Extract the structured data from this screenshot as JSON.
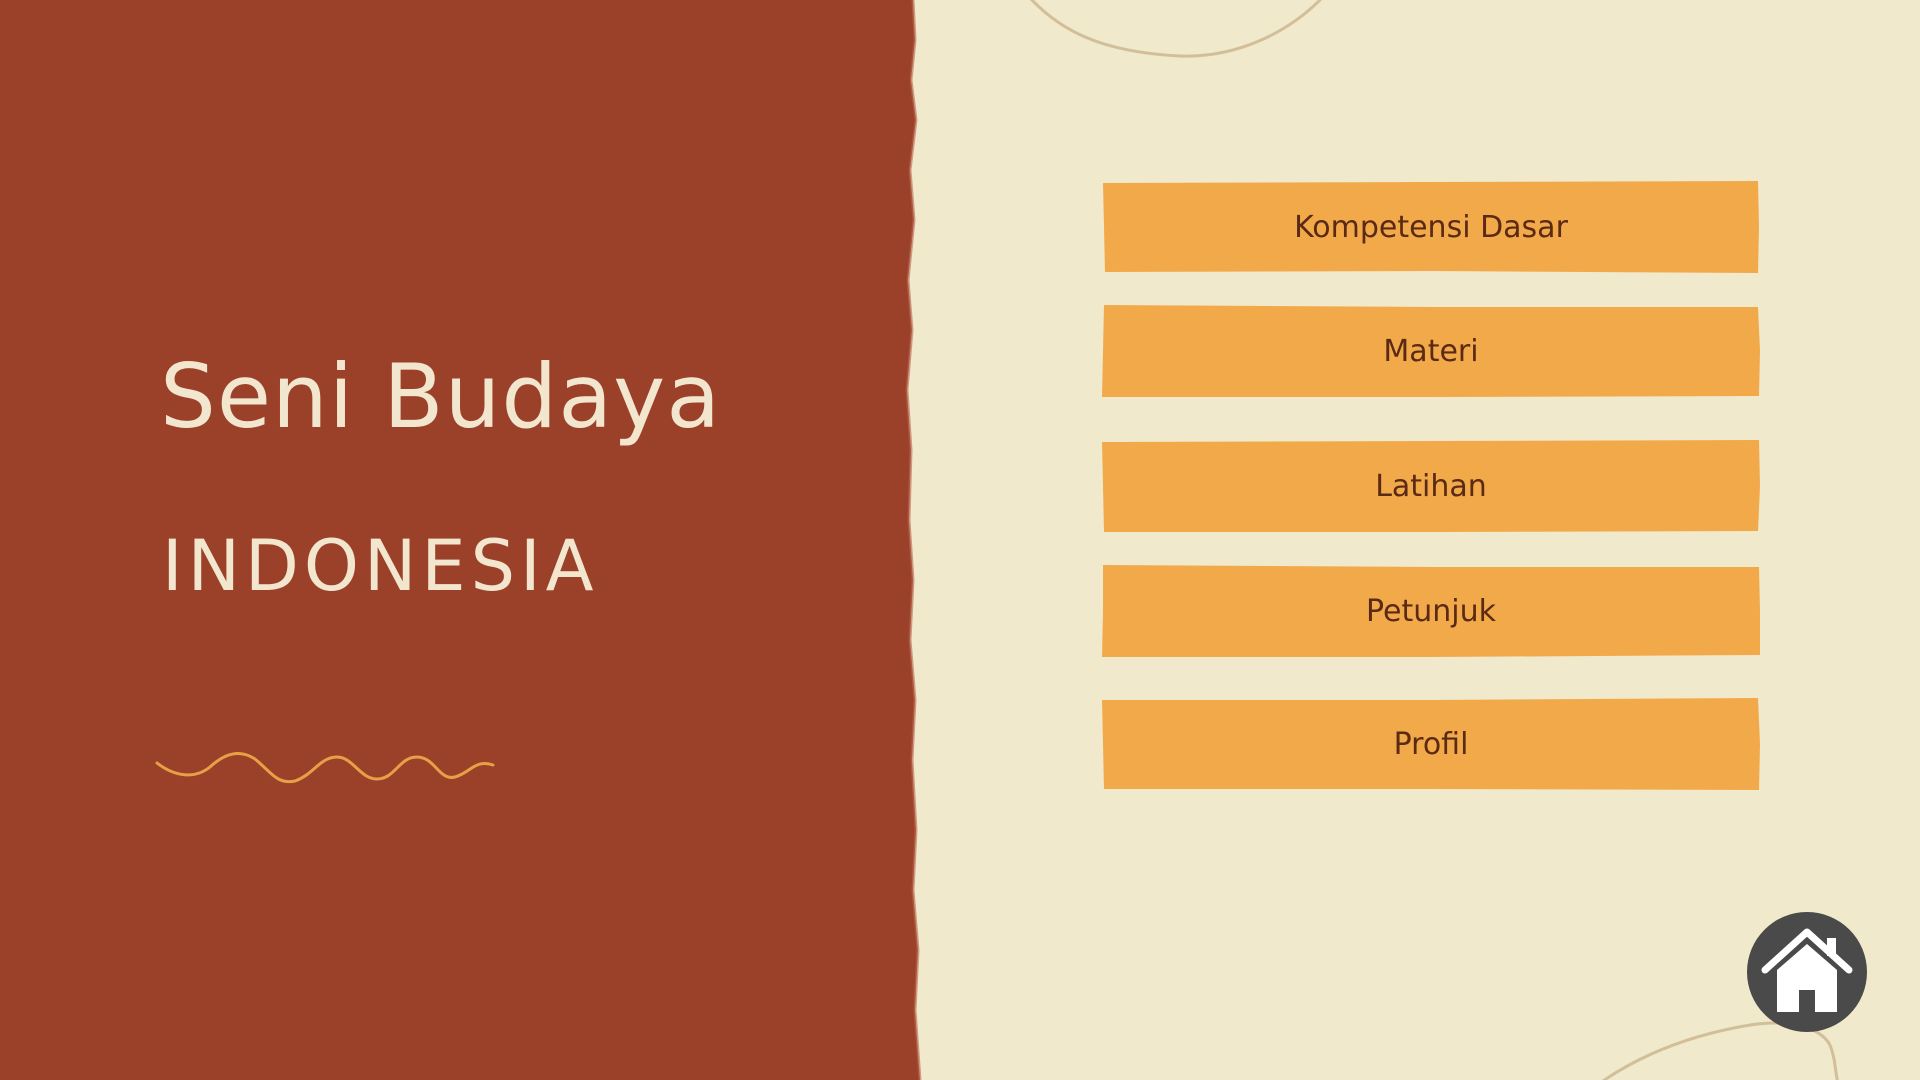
{
  "theme": {
    "left_panel_color": "#9b412a",
    "background_color": "#f0e9cc",
    "title_color": "#f3e6cf",
    "button_color": "#f2a94a",
    "button_text_color": "#5a2a14",
    "squiggle_color": "#e8a046",
    "home_button_color": "#4a4a4a"
  },
  "hero": {
    "title": "Seni Budaya",
    "subtitle": "INDONESIA"
  },
  "menu": {
    "items": [
      {
        "label": "Kompetensi Dasar"
      },
      {
        "label": "Materi"
      },
      {
        "label": "Latihan"
      },
      {
        "label": "Petunjuk"
      },
      {
        "label": "Profil"
      }
    ]
  },
  "home": {
    "icon": "home-icon"
  }
}
